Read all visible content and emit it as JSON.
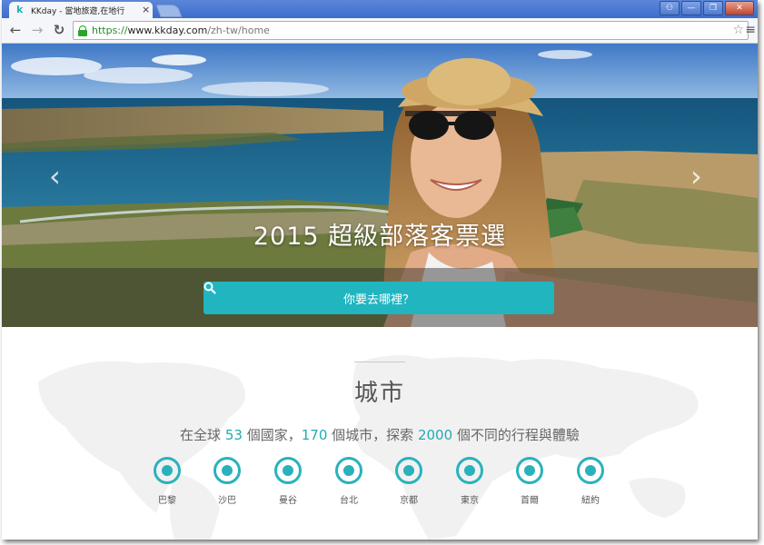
{
  "browser": {
    "tab_title": "KKday - 當地旅遊,在地行",
    "tab_close": "×",
    "url_scheme": "https://",
    "url_host": "www.kkday.com",
    "url_path": "/zh-tw/home",
    "window_controls": {
      "user": "⚇",
      "minimize": "—",
      "restore": "❐",
      "close": "✕"
    }
  },
  "hero": {
    "title": "2015 超級部落客票選",
    "prev_arrow": "‹",
    "next_arrow": "›",
    "search_placeholder": "你要去哪裡？"
  },
  "cities_section": {
    "title": "城市",
    "stats": {
      "prefix": "在全球",
      "countries": "53",
      "mid1": "個國家，",
      "cities": "170",
      "mid2": "個城市，探索",
      "experiences": "2000",
      "suffix": "個不同的行程與體驗"
    },
    "cities": [
      {
        "label": "巴黎"
      },
      {
        "label": "沙巴"
      },
      {
        "label": "曼谷"
      },
      {
        "label": "台北"
      },
      {
        "label": "京都"
      },
      {
        "label": "東京"
      },
      {
        "label": "首爾"
      },
      {
        "label": "紐約"
      }
    ]
  },
  "colors": {
    "accent": "#21b5c0",
    "chrome_blue": "#4a78d2",
    "text_gray": "#666666"
  },
  "icons": {
    "favicon": "k",
    "back": "←",
    "forward": "→",
    "reload": "↻",
    "star": "☆",
    "menu": "≡"
  }
}
